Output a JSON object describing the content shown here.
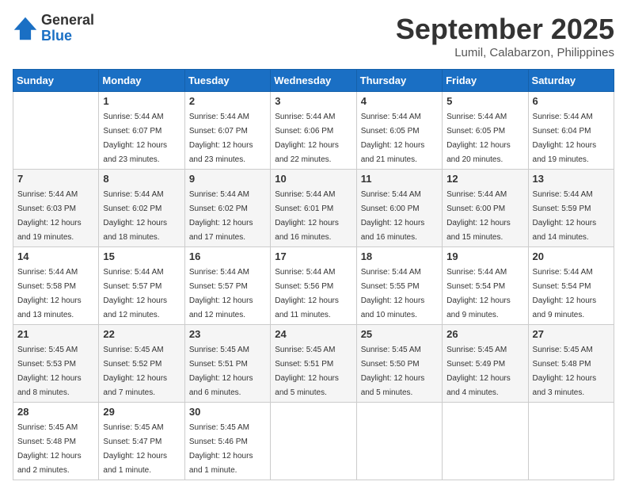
{
  "header": {
    "logo_general": "General",
    "logo_blue": "Blue",
    "month_title": "September 2025",
    "location": "Lumil, Calabarzon, Philippines"
  },
  "days": [
    "Sunday",
    "Monday",
    "Tuesday",
    "Wednesday",
    "Thursday",
    "Friday",
    "Saturday"
  ],
  "weeks": [
    [
      {
        "date": "",
        "sunrise": "",
        "sunset": "",
        "daylight": ""
      },
      {
        "date": "1",
        "sunrise": "Sunrise: 5:44 AM",
        "sunset": "Sunset: 6:07 PM",
        "daylight": "Daylight: 12 hours and 23 minutes."
      },
      {
        "date": "2",
        "sunrise": "Sunrise: 5:44 AM",
        "sunset": "Sunset: 6:07 PM",
        "daylight": "Daylight: 12 hours and 23 minutes."
      },
      {
        "date": "3",
        "sunrise": "Sunrise: 5:44 AM",
        "sunset": "Sunset: 6:06 PM",
        "daylight": "Daylight: 12 hours and 22 minutes."
      },
      {
        "date": "4",
        "sunrise": "Sunrise: 5:44 AM",
        "sunset": "Sunset: 6:05 PM",
        "daylight": "Daylight: 12 hours and 21 minutes."
      },
      {
        "date": "5",
        "sunrise": "Sunrise: 5:44 AM",
        "sunset": "Sunset: 6:05 PM",
        "daylight": "Daylight: 12 hours and 20 minutes."
      },
      {
        "date": "6",
        "sunrise": "Sunrise: 5:44 AM",
        "sunset": "Sunset: 6:04 PM",
        "daylight": "Daylight: 12 hours and 19 minutes."
      }
    ],
    [
      {
        "date": "7",
        "sunrise": "Sunrise: 5:44 AM",
        "sunset": "Sunset: 6:03 PM",
        "daylight": "Daylight: 12 hours and 19 minutes."
      },
      {
        "date": "8",
        "sunrise": "Sunrise: 5:44 AM",
        "sunset": "Sunset: 6:02 PM",
        "daylight": "Daylight: 12 hours and 18 minutes."
      },
      {
        "date": "9",
        "sunrise": "Sunrise: 5:44 AM",
        "sunset": "Sunset: 6:02 PM",
        "daylight": "Daylight: 12 hours and 17 minutes."
      },
      {
        "date": "10",
        "sunrise": "Sunrise: 5:44 AM",
        "sunset": "Sunset: 6:01 PM",
        "daylight": "Daylight: 12 hours and 16 minutes."
      },
      {
        "date": "11",
        "sunrise": "Sunrise: 5:44 AM",
        "sunset": "Sunset: 6:00 PM",
        "daylight": "Daylight: 12 hours and 16 minutes."
      },
      {
        "date": "12",
        "sunrise": "Sunrise: 5:44 AM",
        "sunset": "Sunset: 6:00 PM",
        "daylight": "Daylight: 12 hours and 15 minutes."
      },
      {
        "date": "13",
        "sunrise": "Sunrise: 5:44 AM",
        "sunset": "Sunset: 5:59 PM",
        "daylight": "Daylight: 12 hours and 14 minutes."
      }
    ],
    [
      {
        "date": "14",
        "sunrise": "Sunrise: 5:44 AM",
        "sunset": "Sunset: 5:58 PM",
        "daylight": "Daylight: 12 hours and 13 minutes."
      },
      {
        "date": "15",
        "sunrise": "Sunrise: 5:44 AM",
        "sunset": "Sunset: 5:57 PM",
        "daylight": "Daylight: 12 hours and 12 minutes."
      },
      {
        "date": "16",
        "sunrise": "Sunrise: 5:44 AM",
        "sunset": "Sunset: 5:57 PM",
        "daylight": "Daylight: 12 hours and 12 minutes."
      },
      {
        "date": "17",
        "sunrise": "Sunrise: 5:44 AM",
        "sunset": "Sunset: 5:56 PM",
        "daylight": "Daylight: 12 hours and 11 minutes."
      },
      {
        "date": "18",
        "sunrise": "Sunrise: 5:44 AM",
        "sunset": "Sunset: 5:55 PM",
        "daylight": "Daylight: 12 hours and 10 minutes."
      },
      {
        "date": "19",
        "sunrise": "Sunrise: 5:44 AM",
        "sunset": "Sunset: 5:54 PM",
        "daylight": "Daylight: 12 hours and 9 minutes."
      },
      {
        "date": "20",
        "sunrise": "Sunrise: 5:44 AM",
        "sunset": "Sunset: 5:54 PM",
        "daylight": "Daylight: 12 hours and 9 minutes."
      }
    ],
    [
      {
        "date": "21",
        "sunrise": "Sunrise: 5:45 AM",
        "sunset": "Sunset: 5:53 PM",
        "daylight": "Daylight: 12 hours and 8 minutes."
      },
      {
        "date": "22",
        "sunrise": "Sunrise: 5:45 AM",
        "sunset": "Sunset: 5:52 PM",
        "daylight": "Daylight: 12 hours and 7 minutes."
      },
      {
        "date": "23",
        "sunrise": "Sunrise: 5:45 AM",
        "sunset": "Sunset: 5:51 PM",
        "daylight": "Daylight: 12 hours and 6 minutes."
      },
      {
        "date": "24",
        "sunrise": "Sunrise: 5:45 AM",
        "sunset": "Sunset: 5:51 PM",
        "daylight": "Daylight: 12 hours and 5 minutes."
      },
      {
        "date": "25",
        "sunrise": "Sunrise: 5:45 AM",
        "sunset": "Sunset: 5:50 PM",
        "daylight": "Daylight: 12 hours and 5 minutes."
      },
      {
        "date": "26",
        "sunrise": "Sunrise: 5:45 AM",
        "sunset": "Sunset: 5:49 PM",
        "daylight": "Daylight: 12 hours and 4 minutes."
      },
      {
        "date": "27",
        "sunrise": "Sunrise: 5:45 AM",
        "sunset": "Sunset: 5:48 PM",
        "daylight": "Daylight: 12 hours and 3 minutes."
      }
    ],
    [
      {
        "date": "28",
        "sunrise": "Sunrise: 5:45 AM",
        "sunset": "Sunset: 5:48 PM",
        "daylight": "Daylight: 12 hours and 2 minutes."
      },
      {
        "date": "29",
        "sunrise": "Sunrise: 5:45 AM",
        "sunset": "Sunset: 5:47 PM",
        "daylight": "Daylight: 12 hours and 1 minute."
      },
      {
        "date": "30",
        "sunrise": "Sunrise: 5:45 AM",
        "sunset": "Sunset: 5:46 PM",
        "daylight": "Daylight: 12 hours and 1 minute."
      },
      {
        "date": "",
        "sunrise": "",
        "sunset": "",
        "daylight": ""
      },
      {
        "date": "",
        "sunrise": "",
        "sunset": "",
        "daylight": ""
      },
      {
        "date": "",
        "sunrise": "",
        "sunset": "",
        "daylight": ""
      },
      {
        "date": "",
        "sunrise": "",
        "sunset": "",
        "daylight": ""
      }
    ]
  ]
}
